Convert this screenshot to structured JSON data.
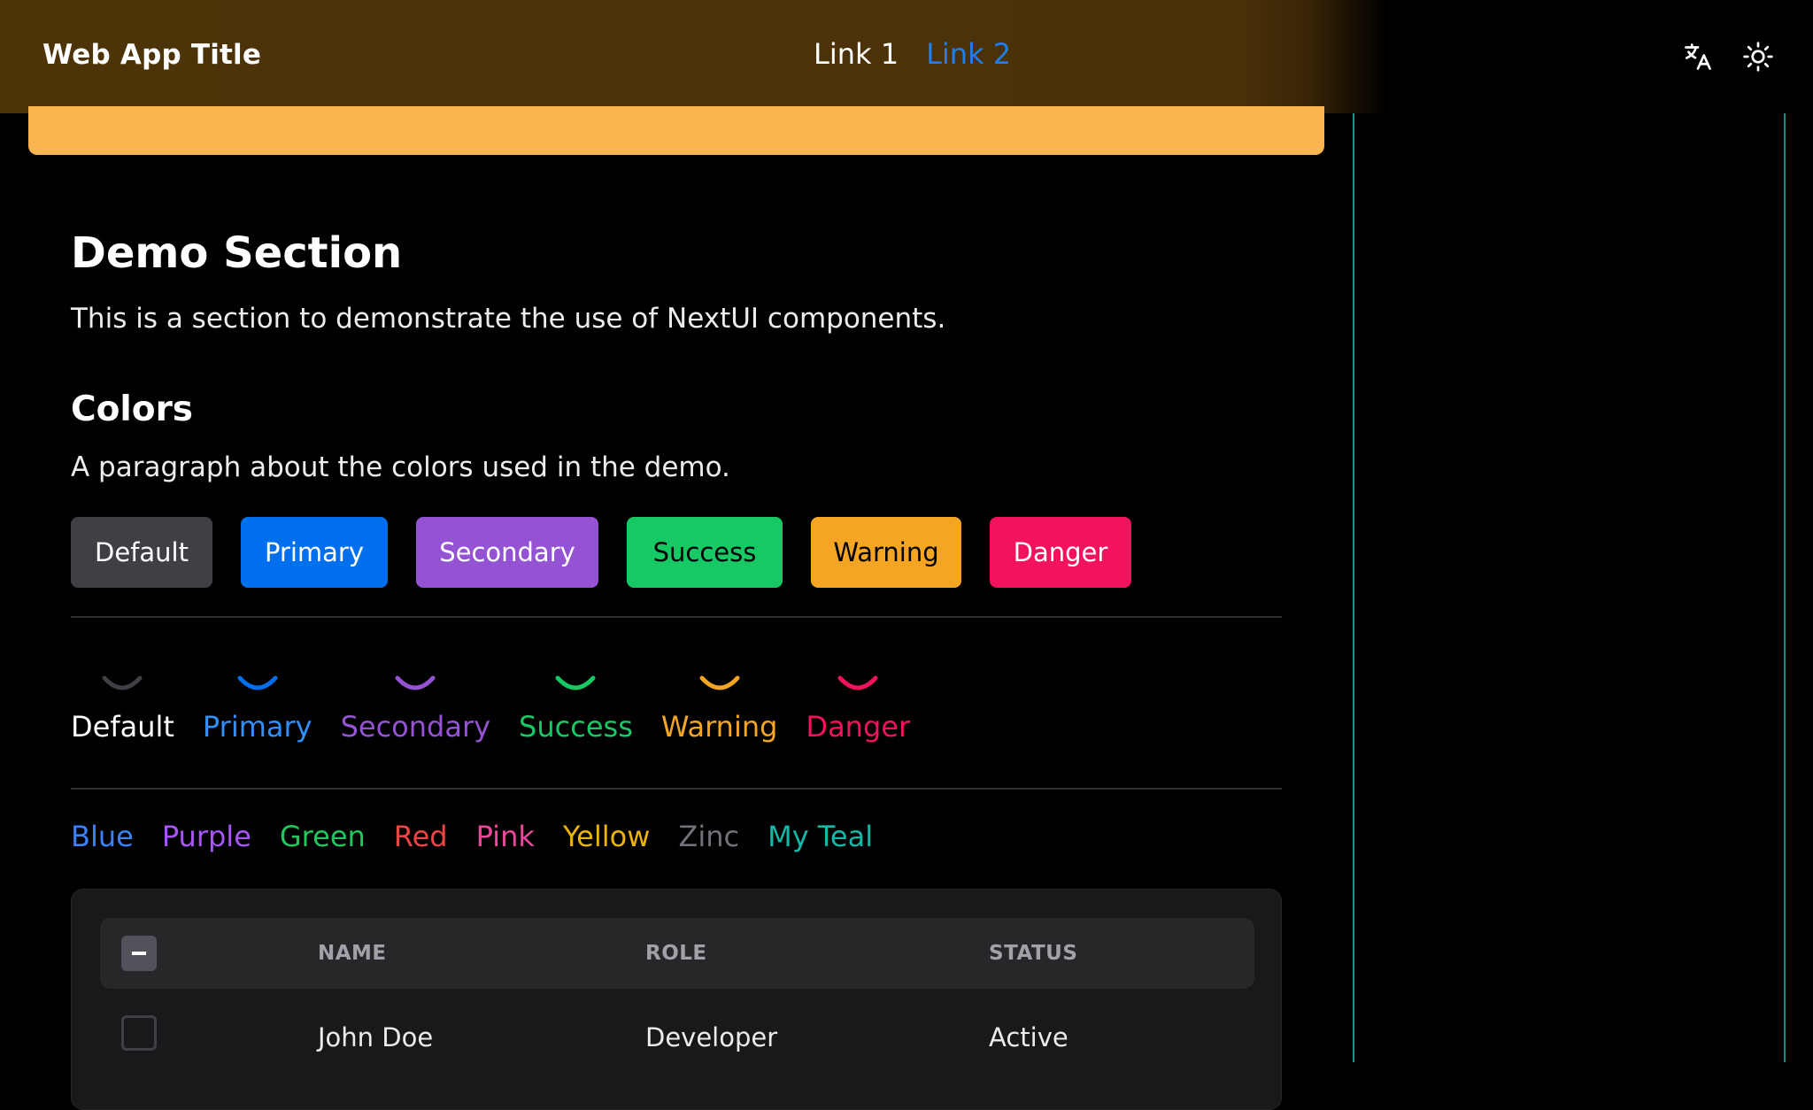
{
  "header": {
    "title": "Web App Title",
    "links": [
      {
        "label": "Link 1",
        "active": false
      },
      {
        "label": "Link 2",
        "active": true
      }
    ],
    "icons": [
      "translate-icon",
      "sun-icon"
    ]
  },
  "main": {
    "section_title": "Demo Section",
    "section_desc": "This is a section to demonstrate the use of NextUI components.",
    "colors_title": "Colors",
    "colors_desc": "A paragraph about the colors used in the demo.",
    "buttons": [
      {
        "label": "Default",
        "bg": "#3f3f46",
        "fg": "#ffffff"
      },
      {
        "label": "Primary",
        "bg": "#006fee",
        "fg": "#ffffff"
      },
      {
        "label": "Secondary",
        "bg": "#9353d3",
        "fg": "#ffffff"
      },
      {
        "label": "Success",
        "bg": "#17c964",
        "fg": "#000000"
      },
      {
        "label": "Warning",
        "bg": "#f5a524",
        "fg": "#000000"
      },
      {
        "label": "Danger",
        "bg": "#f31260",
        "fg": "#ffffff"
      }
    ],
    "spinners": [
      {
        "label": "Default",
        "color": "#3f3f46",
        "label_color": "#ffffff"
      },
      {
        "label": "Primary",
        "color": "#006fee",
        "label_color": "#338ef7"
      },
      {
        "label": "Secondary",
        "color": "#9353d3",
        "label_color": "#9353d3"
      },
      {
        "label": "Success",
        "color": "#17c964",
        "label_color": "#17c964"
      },
      {
        "label": "Warning",
        "color": "#f5a524",
        "label_color": "#f5a524"
      },
      {
        "label": "Danger",
        "color": "#f31260",
        "label_color": "#f31260"
      }
    ],
    "color_links": [
      {
        "label": "Blue",
        "color": "#3b82f6"
      },
      {
        "label": "Purple",
        "color": "#a855f7"
      },
      {
        "label": "Green",
        "color": "#22c55e"
      },
      {
        "label": "Red",
        "color": "#ef4444"
      },
      {
        "label": "Pink",
        "color": "#ec4899"
      },
      {
        "label": "Yellow",
        "color": "#eab308"
      },
      {
        "label": "Zinc",
        "color": "#71717a"
      },
      {
        "label": "My Teal",
        "color": "#14b8a6"
      }
    ],
    "table": {
      "columns": [
        "NAME",
        "ROLE",
        "STATUS"
      ],
      "rows": [
        {
          "name": "John Doe",
          "role": "Developer",
          "status": "Active"
        }
      ]
    }
  },
  "theme": {
    "banner_color": "#f8b550",
    "navbar_color": "#4b3108",
    "active_link_color": "#1f7ef0",
    "accent_teal": "#1a8f80"
  }
}
